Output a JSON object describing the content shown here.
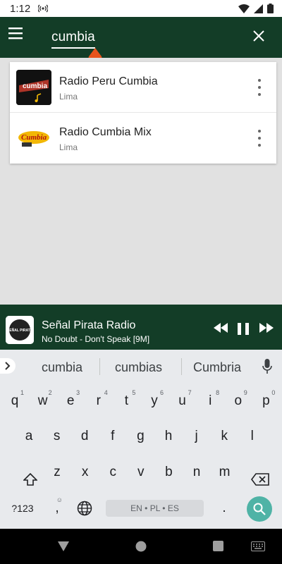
{
  "status_bar": {
    "time": "1:12"
  },
  "search": {
    "query": "cumbia"
  },
  "results": [
    {
      "name": "Radio Peru Cumbia",
      "city": "Lima",
      "logo_text": "cumbia"
    },
    {
      "name": "Radio Cumbia Mix",
      "city": "Lima",
      "logo_text": "Cumbia"
    }
  ],
  "player": {
    "station": "Señal Pirata Radio",
    "now_playing": "No Doubt - Don't Speak [9M]",
    "logo_text": "SEÑAL PIRATA"
  },
  "suggestions": [
    "cumbia",
    "cumbias",
    "Cumbria"
  ],
  "keyboard": {
    "row1": [
      {
        "key": "q",
        "hint": "1"
      },
      {
        "key": "w",
        "hint": "2"
      },
      {
        "key": "e",
        "hint": "3"
      },
      {
        "key": "r",
        "hint": "4"
      },
      {
        "key": "t",
        "hint": "5"
      },
      {
        "key": "y",
        "hint": "6"
      },
      {
        "key": "u",
        "hint": "7"
      },
      {
        "key": "i",
        "hint": "8"
      },
      {
        "key": "o",
        "hint": "9"
      },
      {
        "key": "p",
        "hint": "0"
      }
    ],
    "row2": [
      "a",
      "s",
      "d",
      "f",
      "g",
      "h",
      "j",
      "k",
      "l"
    ],
    "row3": [
      "z",
      "x",
      "c",
      "v",
      "b",
      "n",
      "m"
    ],
    "symbols_label": "?123",
    "comma": ",",
    "period": ".",
    "space_label": "EN • PL • ES"
  },
  "colors": {
    "toolbar": "#133d27",
    "accent_caret": "#e8541c",
    "search_key": "#4fb3a6"
  }
}
